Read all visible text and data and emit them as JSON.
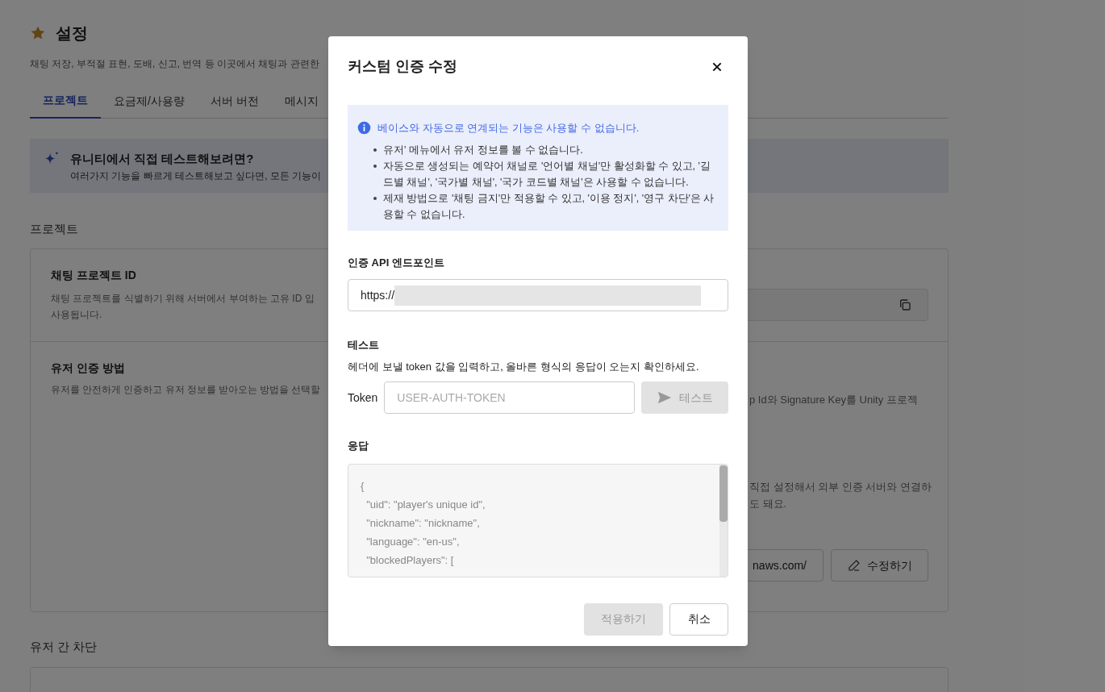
{
  "page": {
    "title": "설정",
    "subtitle": "채팅 저장, 부적절 표현, 도배, 신고, 번역 등 이곳에서 채팅과 관련한",
    "tabs": [
      {
        "label": "프로젝트",
        "selected": true
      },
      {
        "label": "요금제/사용량",
        "selected": false
      },
      {
        "label": "서버 버전",
        "selected": false
      },
      {
        "label": "메시지",
        "selected": false
      }
    ],
    "banner": {
      "title": "유니티에서 직접 테스트해보려면?",
      "text": "여러가지 기능을 빠르게 테스트해보고 싶다면, 모든 기능이"
    },
    "section_title": "프로젝트",
    "project_id": {
      "title": "채팅 프로젝트 ID",
      "description": [
        "채팅 프로젝트를 식별하기 위해 서버에서 부여하는 고유 ID 입",
        "사용됩니다."
      ]
    },
    "auth": {
      "title": "유저 인증 방법",
      "description": "유저를 안전하게 인증하고 유저 정보를 받아오는 방법을 선택할",
      "option_1_text": "p Id와 Signature Key를 Unity 프로젝",
      "option_2_text": [
        "직접 설정해서 외부 인증 서버와 연결하",
        "도 돼요."
      ],
      "endpoint_value": "naws.com/",
      "edit_button": "수정하기"
    },
    "next_section_title": "유저 간 차단"
  },
  "dialog": {
    "title": "커스텀 인증 수정",
    "notice": {
      "title": "베이스와 자동으로 연계되는 기능은 사용할 수 없습니다.",
      "items": [
        "유저' 메뉴에서 유저 정보를 볼 수 없습니다.",
        "자동으로 생성되는 예약어 채널로 '언어별 채널'만 활성화할 수 있고, '길드별 채널', '국가별 채널', '국가 코드별 채널'은 사용할 수 없습니다.",
        "제재 방법으로 '채팅 금지'만 적용할 수 있고, '이용 정지', '영구 차단'은 사용할 수 없습니다."
      ]
    },
    "endpoint": {
      "label": "인증 API 엔드포인트",
      "value": "https://"
    },
    "test": {
      "label": "테스트",
      "description": "헤더에 보낼 token 값을 입력하고, 올바른 형식의 응답이 오는지 확인하세요.",
      "token_label": "Token",
      "token_placeholder": "USER-AUTH-TOKEN",
      "button": "테스트",
      "button_disabled": true
    },
    "response": {
      "label": "응답",
      "lines": [
        "{",
        "  \"uid\": \"player's unique id\",",
        "  \"nickname\": \"nickname\",",
        "  \"language\": \"en-us\",",
        "  \"blockedPlayers\": ["
      ]
    },
    "buttons": [
      {
        "label": "적용하기",
        "kind": "primary",
        "disabled": true
      },
      {
        "label": "취소",
        "kind": "secondary",
        "disabled": false
      }
    ]
  }
}
